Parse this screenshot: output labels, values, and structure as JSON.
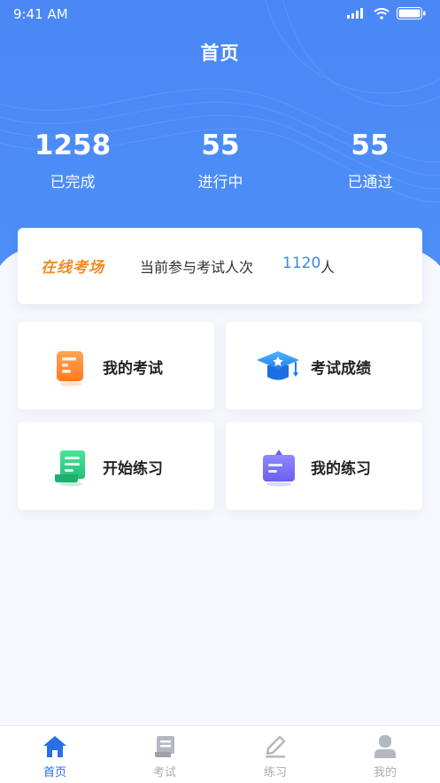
{
  "status_bar": {
    "time": "9:41 AM"
  },
  "header": {
    "title": "首页"
  },
  "stats": [
    {
      "value": "1258",
      "label": "已完成"
    },
    {
      "value": "55",
      "label": "进行中"
    },
    {
      "value": "55",
      "label": "已通过"
    }
  ],
  "online": {
    "tag": "在线考场",
    "desc": "当前参与考试人次",
    "count": "1120",
    "unit": "人"
  },
  "tiles": [
    {
      "label": "我的考试",
      "icon": "document-icon"
    },
    {
      "label": "考试成绩",
      "icon": "graduation-cap-icon"
    },
    {
      "label": "开始练习",
      "icon": "scroll-icon"
    },
    {
      "label": "我的练习",
      "icon": "clipboard-icon"
    }
  ],
  "tabs": [
    {
      "label": "首页",
      "icon": "home-icon",
      "active": true
    },
    {
      "label": "考试",
      "icon": "book-icon",
      "active": false
    },
    {
      "label": "练习",
      "icon": "pencil-icon",
      "active": false
    },
    {
      "label": "我的",
      "icon": "user-icon",
      "active": false
    }
  ],
  "colors": {
    "hero_blue": "#4a8cf7",
    "accent_orange": "#f08a24",
    "count_blue": "#3d8bd9",
    "tab_active": "#2a6fe8",
    "tab_inactive": "#a9adb5"
  }
}
